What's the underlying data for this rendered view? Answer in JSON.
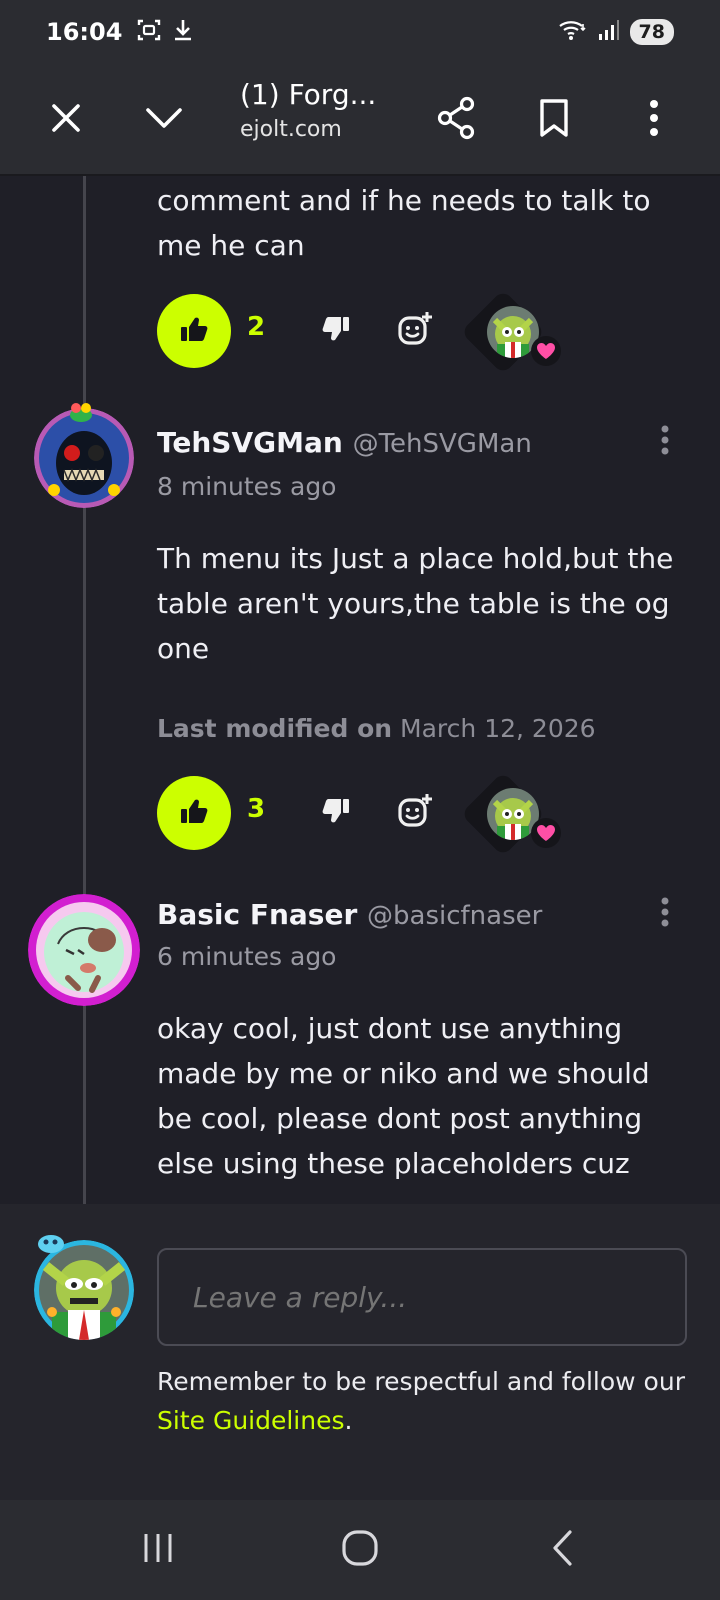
{
  "status_bar": {
    "time": "16:04",
    "battery": "78"
  },
  "toolbar": {
    "title": "(1) Forg...",
    "url": "ejolt.com"
  },
  "comments": [
    {
      "text": "comment and if he needs to talk to me he can",
      "like_count": "2"
    },
    {
      "author": "TehSVGMan",
      "handle": "@TehSVGMan",
      "time": "8 minutes ago",
      "text": "Th menu its Just a place hold,but the table aren't yours,the table is the og one",
      "modified_label": "Last modified on",
      "modified_date": "March 12, 2026",
      "like_count": "3"
    },
    {
      "author": "Basic Fnaser",
      "handle": "@basicfnaser",
      "time": "6 minutes ago",
      "text": "okay cool, just dont use anything made by me or niko and we should be cool, please dont post anything else using these placeholders cuz"
    }
  ],
  "reply": {
    "placeholder": "Leave a reply...",
    "reminder_text": "Remember to be respectful and follow our ",
    "guidelines_link": "Site Guidelines",
    "reminder_end": "."
  },
  "colors": {
    "accent": "#ccff00",
    "heart": "#ff4fa6",
    "background": "#1f1f27"
  }
}
